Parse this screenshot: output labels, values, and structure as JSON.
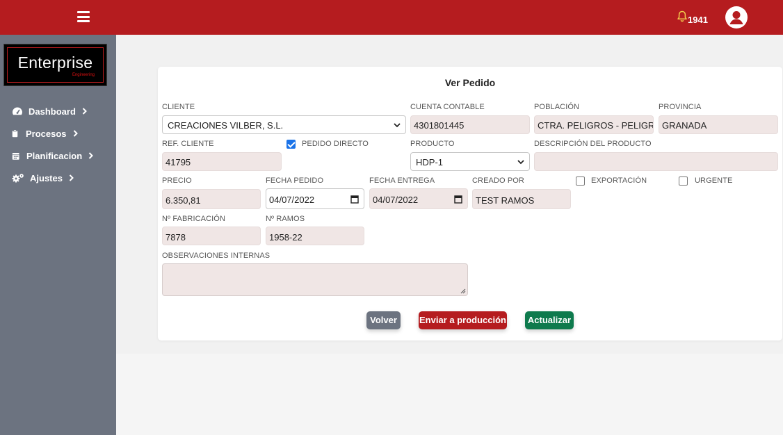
{
  "header": {
    "notification_count": "1941",
    "colors": {
      "brand": "#b51c1f",
      "bell": "#f2c94c"
    },
    "icons": [
      "hamburger-icon",
      "bell-icon",
      "user-avatar-icon"
    ]
  },
  "sidebar": {
    "logo_text": "Enterprise",
    "logo_sub": "Engineering",
    "items": [
      {
        "label": "Dashboard",
        "icon": "dashboard-icon"
      },
      {
        "label": "Procesos",
        "icon": "clipboard-icon"
      },
      {
        "label": "Planificacion",
        "icon": "calendar-icon"
      },
      {
        "label": "Ajustes",
        "icon": "cogs-icon"
      }
    ]
  },
  "form": {
    "title": "Ver Pedido",
    "cliente": {
      "label": "CLIENTE",
      "value": "CREACIONES VILBER, S.L."
    },
    "cuenta_contable": {
      "label": "CUENTA CONTABLE",
      "value": "4301801445"
    },
    "poblacion": {
      "label": "POBLACIÓN",
      "value": "CTRA. PELIGROS - PELIGROS"
    },
    "provincia": {
      "label": "PROVINCIA",
      "value": "GRANADA"
    },
    "ref_cliente": {
      "label": "REF. CLIENTE",
      "value": "41795"
    },
    "pedido_directo": {
      "label": "PEDIDO DIRECTO",
      "checked": true
    },
    "producto": {
      "label": "PRODUCTO",
      "value": "HDP-1"
    },
    "descripcion": {
      "label": "DESCRIPCIÓN DEL PRODUCTO",
      "value": ""
    },
    "precio": {
      "label": "PRECIO",
      "value": "6.350,81"
    },
    "fecha_pedido": {
      "label": "FECHA PEDIDO",
      "value": "04/07/2022"
    },
    "fecha_entrega": {
      "label": "FECHA ENTREGA",
      "value": "04/07/2022"
    },
    "creado_por": {
      "label": "CREADO POR",
      "value": "TEST RAMOS"
    },
    "exportacion": {
      "label": "EXPORTACIÓN",
      "checked": false
    },
    "urgente": {
      "label": "URGENTE",
      "checked": false
    },
    "n_fabricacion": {
      "label": "Nº FABRICACIÓN",
      "value": "7878"
    },
    "n_ramos": {
      "label": "Nº RAMOS",
      "value": "1958-22"
    },
    "observaciones": {
      "label": "OBSERVACIONES INTERNAS",
      "value": ""
    }
  },
  "buttons": {
    "volver": "Volver",
    "enviar": "Enviar a producción",
    "actualizar": "Actualizar"
  }
}
